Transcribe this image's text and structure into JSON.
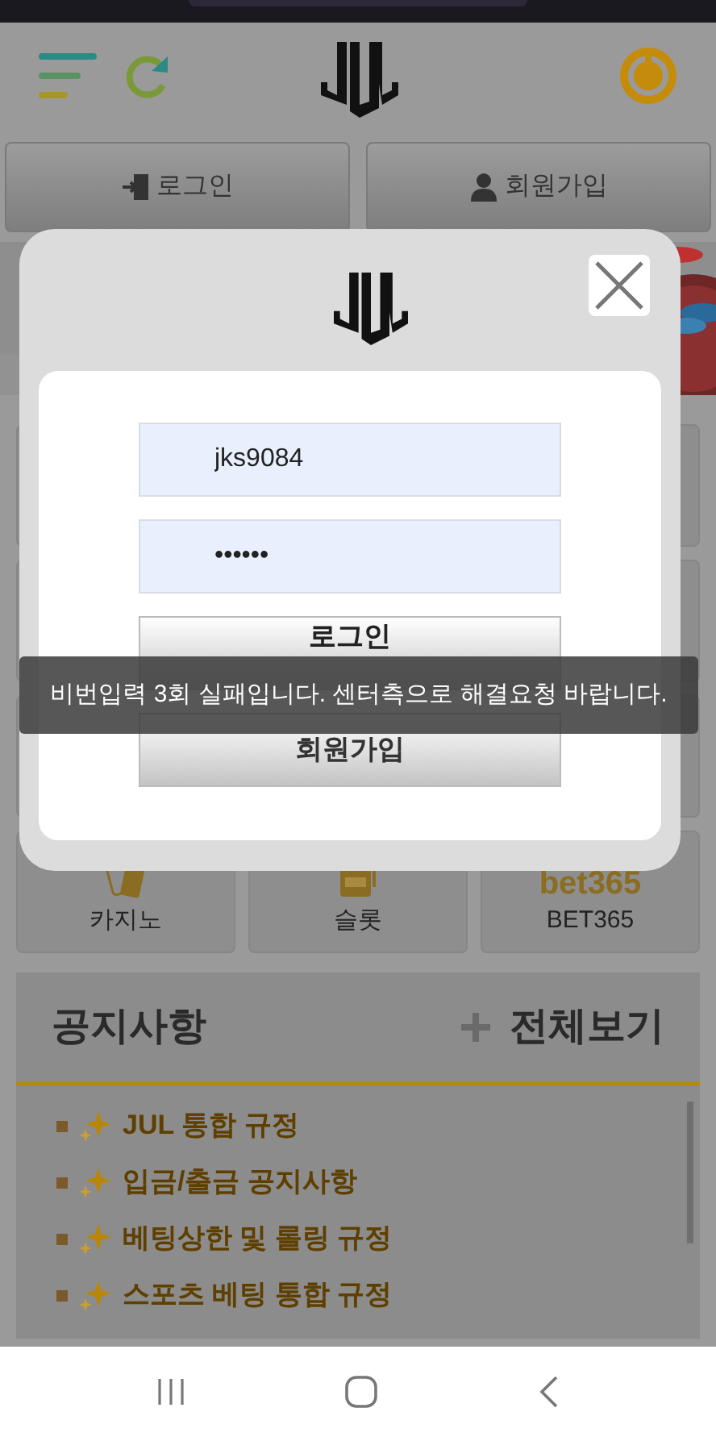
{
  "auth_buttons": [
    {
      "label": "로그인",
      "kind": "door"
    },
    {
      "label": "회원가입",
      "kind": "user"
    }
  ],
  "game_cards": [
    {
      "label": "카지노",
      "kind": "cards"
    },
    {
      "label": "슬롯",
      "kind": "slot"
    },
    {
      "label": "BET365",
      "kind": "logo",
      "logo_text": "bet365"
    }
  ],
  "notice": {
    "title": "공지사항",
    "more": "전체보기",
    "items": [
      "JUL 통합 규정",
      "입금/출금 공지사항",
      "베팅상한 및 롤링 규정",
      "스포츠 베팅 통합 규정"
    ]
  },
  "login_modal": {
    "username": "jks9084",
    "password": "••••••",
    "login_button": "로그인",
    "signup_button": "회원가입"
  },
  "toast": "비번입력 3회 실패입니다. 센터측으로 해결요청 바랍니다."
}
